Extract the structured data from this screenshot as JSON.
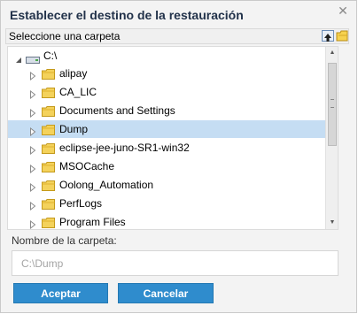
{
  "dialog": {
    "title": "Establecer el destino de la restauración",
    "close_glyph": "✕"
  },
  "toolbar": {
    "label": "Seleccione una carpeta",
    "up_icon": "folder-up-icon",
    "new_folder_icon": "new-folder-icon"
  },
  "tree": {
    "drive": "C:\\",
    "items": [
      {
        "label": "alipay",
        "selected": false
      },
      {
        "label": "CA_LIC",
        "selected": false
      },
      {
        "label": "Documents and Settings",
        "selected": false
      },
      {
        "label": "Dump",
        "selected": true
      },
      {
        "label": "eclipse-jee-juno-SR1-win32",
        "selected": false
      },
      {
        "label": "MSOCache",
        "selected": false
      },
      {
        "label": "Oolong_Automation",
        "selected": false
      },
      {
        "label": "PerfLogs",
        "selected": false
      },
      {
        "label": "Program Files",
        "selected": false
      }
    ],
    "scroll_position": 0.0
  },
  "folder_name": {
    "label": "Nombre de la carpeta:",
    "placeholder": "C:\\Dump"
  },
  "buttons": {
    "accept": "Aceptar",
    "cancel": "Cancelar"
  },
  "colors": {
    "accent": "#2f8ccd",
    "selection": "#c5ddf3",
    "folder": "#f4d25b"
  }
}
